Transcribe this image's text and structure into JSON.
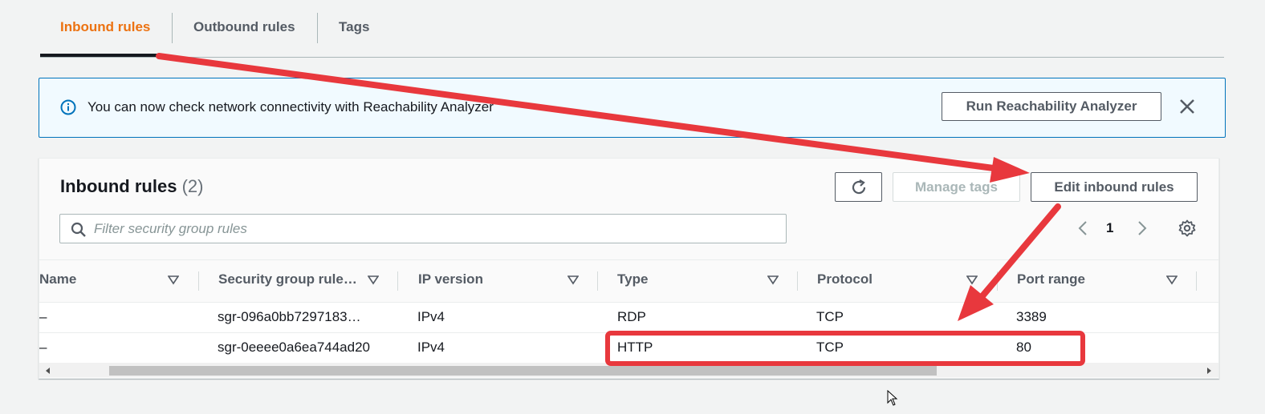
{
  "tabs": [
    {
      "label": "Inbound rules",
      "active": true
    },
    {
      "label": "Outbound rules",
      "active": false
    },
    {
      "label": "Tags",
      "active": false
    }
  ],
  "banner": {
    "icon": "info-icon",
    "text": "You can now check network connectivity with Reachability Analyzer",
    "action_label": "Run Reachability Analyzer",
    "close_icon": "close-icon"
  },
  "panel": {
    "title": "Inbound rules",
    "count": "(2)",
    "refresh_icon": "refresh-icon",
    "manage_tags_label": "Manage tags",
    "edit_label": "Edit inbound rules",
    "search_placeholder": "Filter security group rules",
    "page": "1"
  },
  "table": {
    "columns": [
      "Name",
      "Security group rule…",
      "IP version",
      "Type",
      "Protocol",
      "Port range"
    ],
    "rows": [
      {
        "name": "–",
        "rule_id": "sgr-096a0bb7297183…",
        "ip_version": "IPv4",
        "type": "RDP",
        "protocol": "TCP",
        "port_range": "3389"
      },
      {
        "name": "–",
        "rule_id": "sgr-0eeee0a6ea744ad20",
        "ip_version": "IPv4",
        "type": "HTTP",
        "protocol": "TCP",
        "port_range": "80"
      }
    ]
  },
  "annotation_colors": {
    "arrow": "#e8383d",
    "highlight": "#e8383d"
  }
}
